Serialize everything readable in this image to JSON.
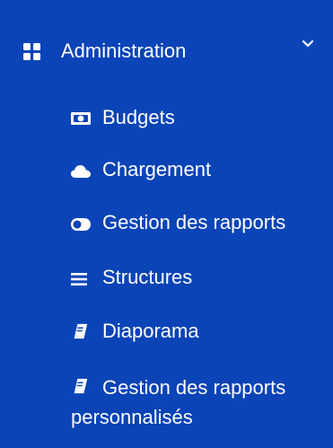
{
  "colors": {
    "background": "#0b44b7",
    "text": "#ffffff"
  },
  "sidebar": {
    "section": {
      "label": "Administration",
      "icon": "grid-icon",
      "expand_icon": "chevron-down-icon"
    },
    "items": [
      {
        "label": "Budgets",
        "icon": "money-bill-icon"
      },
      {
        "label": "Chargement",
        "icon": "cloud-icon"
      },
      {
        "label": "Gestion des rapports",
        "icon": "toggle-icon"
      },
      {
        "label": "Structures",
        "icon": "bars-icon"
      },
      {
        "label": "Diaporama",
        "icon": "book-icon"
      },
      {
        "label": "Gestion des rapports personnalisés",
        "icon": "book-icon"
      }
    ]
  }
}
